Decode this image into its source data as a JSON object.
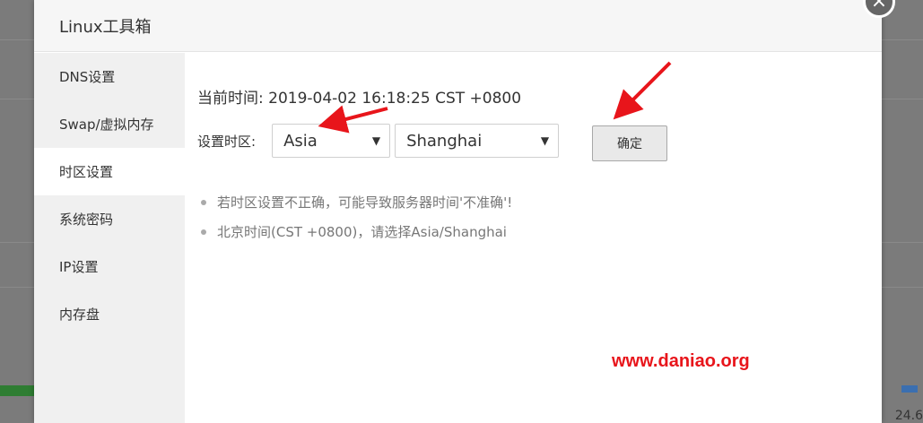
{
  "modal": {
    "title": "Linux工具箱",
    "close_label": "×"
  },
  "sidebar": {
    "items": [
      {
        "label": "DNS设置",
        "active": false
      },
      {
        "label": "Swap/虚拟内存",
        "active": false
      },
      {
        "label": "时区设置",
        "active": true
      },
      {
        "label": "系统密码",
        "active": false
      },
      {
        "label": "IP设置",
        "active": false
      },
      {
        "label": "内存盘",
        "active": false
      }
    ]
  },
  "timezone": {
    "current_time": "当前时间: 2019-04-02 16:18:25 CST +0800",
    "set_label": "设置时区:",
    "region_value": "Asia",
    "city_value": "Shanghai",
    "confirm_label": "确定",
    "notes": [
      "若时区设置不正确，可能导致服务器时间'不准确'!",
      "北京时间(CST +0800)，请选择Asia/Shanghai"
    ]
  },
  "watermark": "www.daniao.org",
  "background": {
    "corner_number": "24.6"
  },
  "colors": {
    "arrow": "#e8151b",
    "overlay": "#7b7b7b"
  }
}
